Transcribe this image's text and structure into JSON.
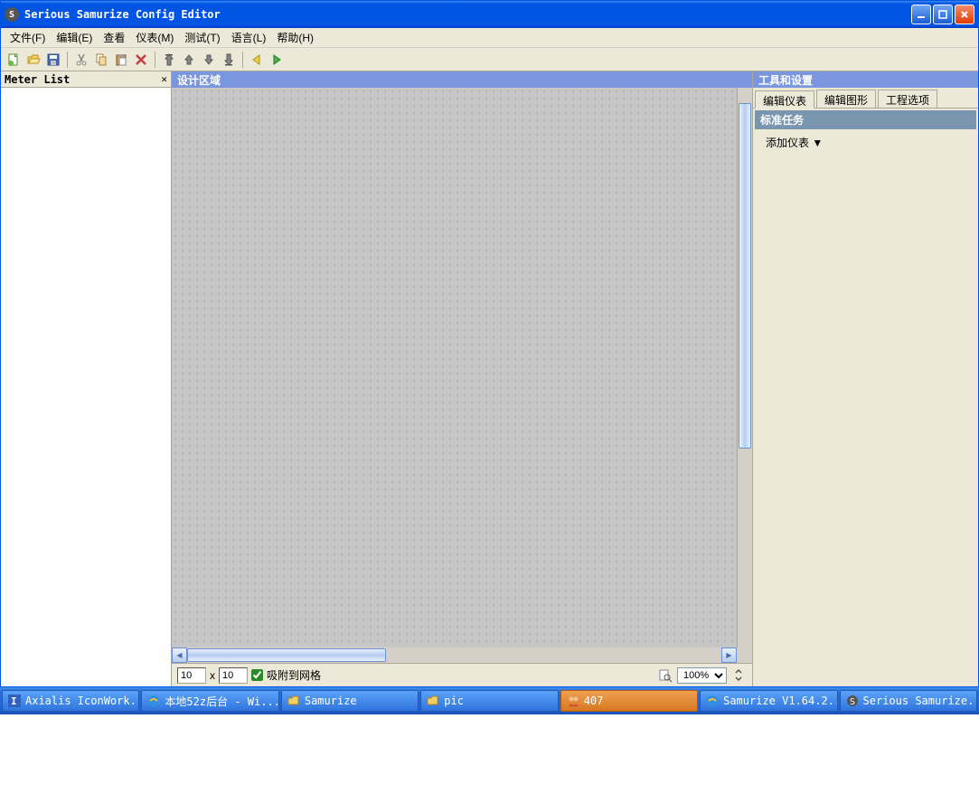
{
  "window": {
    "title": "Serious Samurize Config Editor"
  },
  "menu": {
    "file": "文件(F)",
    "edit": "编辑(E)",
    "view": "查看",
    "meter": "仪表(M)",
    "test": "测试(T)",
    "lang": "语言(L)",
    "help": "帮助(H)"
  },
  "meter_panel": {
    "title": "Meter List"
  },
  "design": {
    "title": "设计区域"
  },
  "bottom": {
    "width": "10",
    "height": "10",
    "x_label": "x",
    "snap_label": "吸附到网格",
    "zoom": "100%"
  },
  "right": {
    "title": "工具和设置",
    "tab1": "编辑仪表",
    "tab2": "编辑图形",
    "tab3": "工程选项",
    "task_header": "标准任务",
    "add_meter": "添加仪表 ▼"
  },
  "taskbar": {
    "t1": "Axialis IconWork...",
    "t2": "本地52z后台 - Wi...",
    "t3": "Samurize",
    "t4": "pic",
    "t5": "407",
    "t6": "Samurize V1.64.2...",
    "t7": "Serious Samurize..."
  }
}
